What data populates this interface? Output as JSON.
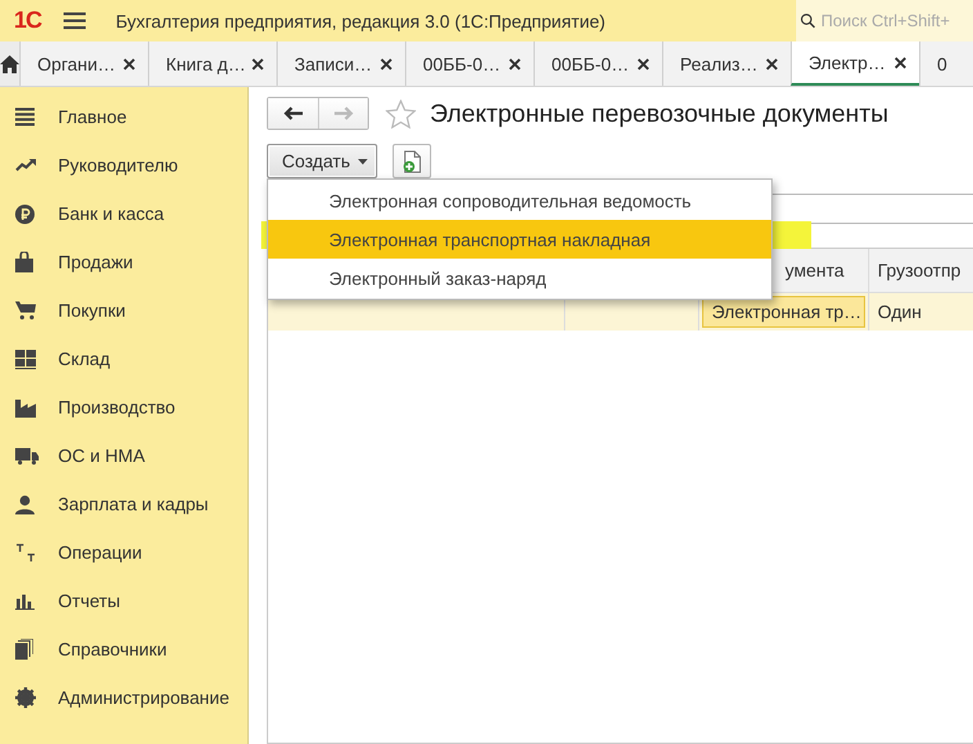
{
  "app": {
    "logo": "1С",
    "title": "Бухгалтерия предприятия, редакция 3.0  (1С:Предприятие)",
    "search": {
      "placeholder": "Поиск Ctrl+Shift+"
    }
  },
  "tabs": [
    {
      "label": "Органи…",
      "selected": false
    },
    {
      "label": "Книга д…",
      "selected": false
    },
    {
      "label": "Записи…",
      "selected": false
    },
    {
      "label": "00ББ-0…",
      "selected": false
    },
    {
      "label": "00ББ-0…",
      "selected": false
    },
    {
      "label": "Реализ…",
      "selected": false
    },
    {
      "label": "Электр…",
      "selected": true
    },
    {
      "label": "0",
      "selected": false
    }
  ],
  "sidebar": {
    "items": [
      {
        "label": "Главное"
      },
      {
        "label": "Руководителю"
      },
      {
        "label": "Банк и касса"
      },
      {
        "label": "Продажи"
      },
      {
        "label": "Покупки"
      },
      {
        "label": "Склад"
      },
      {
        "label": "Производство"
      },
      {
        "label": "ОС и НМА"
      },
      {
        "label": "Зарплата и кадры"
      },
      {
        "label": "Операции"
      },
      {
        "label": "Отчеты"
      },
      {
        "label": "Справочники"
      },
      {
        "label": "Администрирование"
      }
    ]
  },
  "page": {
    "title": "Электронные перевозочные документы",
    "back_disabled": false,
    "forward_disabled": true,
    "create_button": "Создать",
    "create_menu": [
      {
        "label": "Электронная сопроводительная ведомость",
        "selected": false
      },
      {
        "label": "Электронная транспортная накладная",
        "selected": true
      },
      {
        "label": "Электронный заказ-наряд",
        "selected": false
      }
    ],
    "table": {
      "columns": [
        "умента",
        "Грузоотпр"
      ],
      "rows": [
        {
          "cells": [
            "Электронная тр…",
            "Один"
          ],
          "selected": true
        }
      ]
    }
  }
}
